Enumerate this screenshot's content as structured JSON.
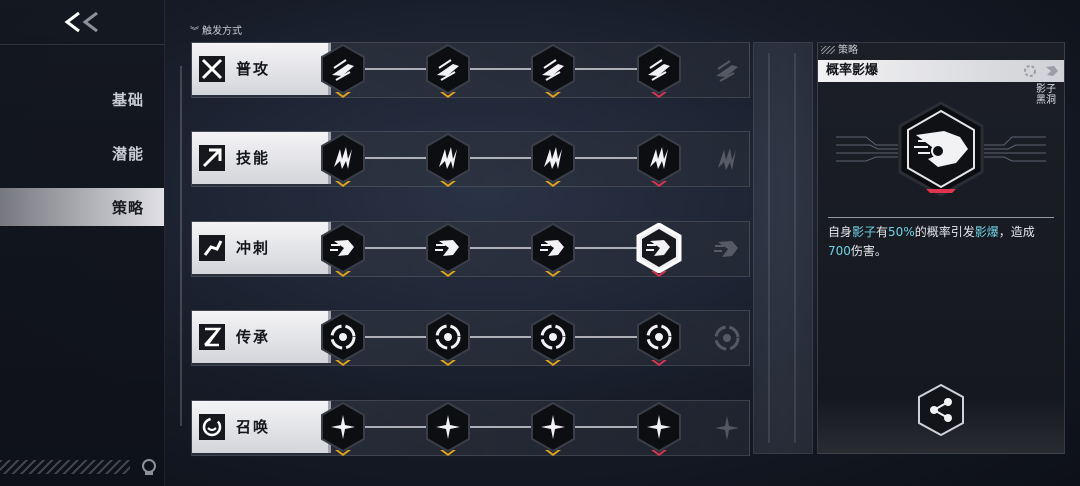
{
  "sidebar": {
    "back_label": "<<",
    "items": [
      {
        "label": "基础",
        "active": false
      },
      {
        "label": "潜能",
        "active": false
      },
      {
        "label": "策略",
        "active": true
      }
    ]
  },
  "tree": {
    "header": "触发方式",
    "rows": [
      {
        "label": "普攻",
        "icon": "crossed-swords-icon",
        "node_icon": "claw-slash-icon",
        "marks": [
          "gold",
          "gold",
          "gold",
          "red"
        ]
      },
      {
        "label": "技能",
        "icon": "arrow-burst-icon",
        "node_icon": "lightning-claw-icon",
        "marks": [
          "gold",
          "gold",
          "gold",
          "red"
        ]
      },
      {
        "label": "冲刺",
        "icon": "dash-runner-icon",
        "node_icon": "dash-figure-icon",
        "marks": [
          "gold",
          "gold",
          "gold",
          "red"
        ]
      },
      {
        "label": "传承",
        "icon": "hourglass-icon",
        "node_icon": "black-hole-icon",
        "marks": [
          "gold",
          "gold",
          "gold",
          "red"
        ]
      },
      {
        "label": "召唤",
        "icon": "summon-circle-icon",
        "node_icon": "star-spark-icon",
        "marks": [
          "gold",
          "gold",
          "gold",
          "red"
        ]
      }
    ]
  },
  "detail": {
    "section_label": "策略",
    "title": "概率影爆",
    "tag": "影子黑洞",
    "desc_parts": [
      {
        "text": "自身",
        "hl": false
      },
      {
        "text": "影子",
        "hl": true
      },
      {
        "text": "有",
        "hl": false
      },
      {
        "text": "50%",
        "hl": true
      },
      {
        "text": "的概率引发",
        "hl": false
      },
      {
        "text": "影爆",
        "hl": true
      },
      {
        "text": "，造成",
        "hl": false
      },
      {
        "text": "700",
        "hl": true
      },
      {
        "text": "伤害。",
        "hl": false
      }
    ],
    "big_icon": "shadow-dash-icon",
    "share_icon": "share-icon"
  },
  "colors": {
    "accent_gold": "#e2a41b",
    "accent_red": "#e0334f",
    "highlight_cyan": "#6fd3e6"
  }
}
